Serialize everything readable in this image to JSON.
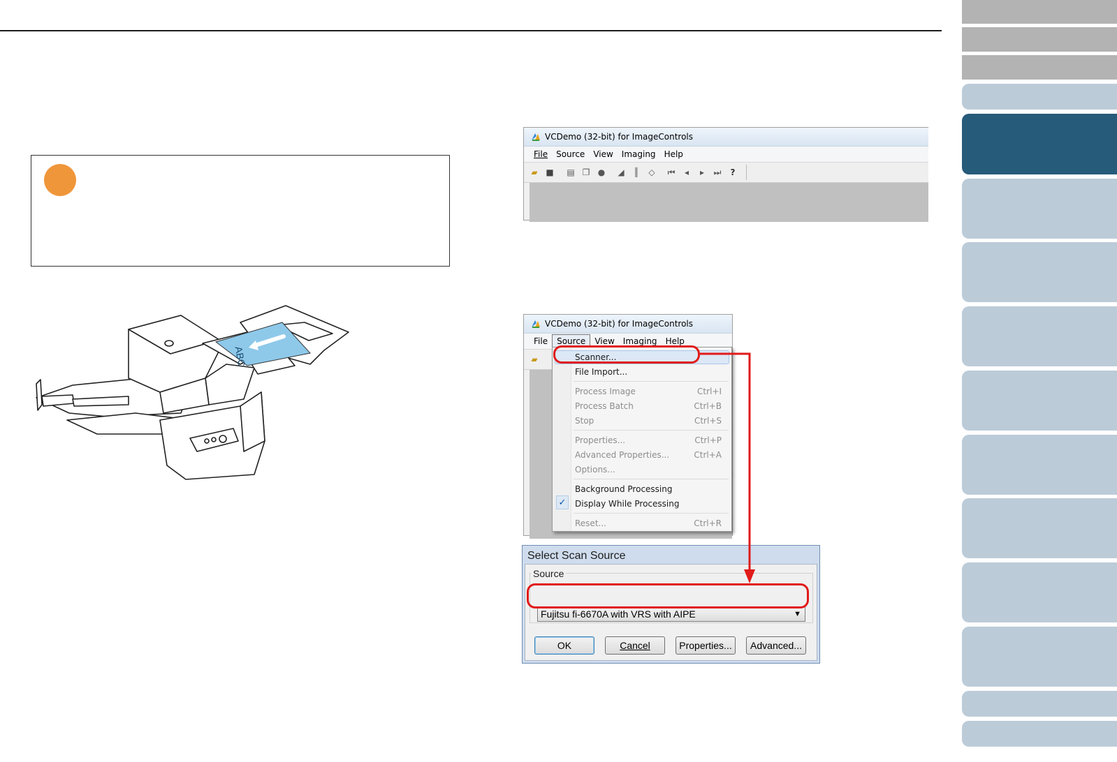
{
  "vcdemo_window": {
    "title": "VCDemo (32-bit) for ImageControls",
    "menu": [
      "File",
      "Source",
      "View",
      "Imaging",
      "Help"
    ],
    "toolbar_icons": [
      "open-folder-icon",
      "save-icon",
      "page-icon",
      "copy-icon",
      "stop-icon",
      "scanner-icon",
      "barcode-icon",
      "eraser-icon",
      "first-page-icon",
      "prev-page-icon",
      "next-page-icon",
      "last-page-icon",
      "help-icon"
    ]
  },
  "vcdemo_window_menu_open": {
    "title": "VCDemo (32-bit) for ImageControls",
    "menu": [
      "File",
      "Source",
      "View",
      "Imaging",
      "Help"
    ]
  },
  "source_menu": {
    "items": [
      {
        "label": "Scanner...",
        "shortcut": "",
        "enabled": true
      },
      {
        "label": "File Import...",
        "shortcut": "",
        "enabled": true
      },
      {
        "label": "Process Image",
        "shortcut": "Ctrl+I",
        "enabled": false
      },
      {
        "label": "Process Batch",
        "shortcut": "Ctrl+B",
        "enabled": false
      },
      {
        "label": "Stop",
        "shortcut": "Ctrl+S",
        "enabled": false
      },
      {
        "label": "Properties...",
        "shortcut": "Ctrl+P",
        "enabled": false
      },
      {
        "label": "Advanced Properties...",
        "shortcut": "Ctrl+A",
        "enabled": false
      },
      {
        "label": "Options...",
        "shortcut": "",
        "enabled": false
      },
      {
        "label": "Background Processing",
        "shortcut": "",
        "enabled": true
      },
      {
        "label": "Display While Processing",
        "shortcut": "",
        "enabled": true,
        "checked": true
      },
      {
        "label": "Reset...",
        "shortcut": "Ctrl+R",
        "enabled": false
      }
    ],
    "check_mark": "✓"
  },
  "select_scan_source": {
    "title": "Select Scan Source",
    "group_label": "Source",
    "selected_source": "Fujitsu fi-6670A with VRS with AIPE",
    "buttons": {
      "ok": "OK",
      "cancel": "Cancel",
      "properties": "Properties...",
      "advanced": "Advanced..."
    }
  },
  "illustration": {
    "document_text": "ABC"
  },
  "colors": {
    "attention": "#f0963a",
    "highlight": "#e11a1a",
    "tab_active": "#275b7a",
    "tab_inactive": "#bccbd8",
    "tab_gray": "#b3b3b3"
  }
}
